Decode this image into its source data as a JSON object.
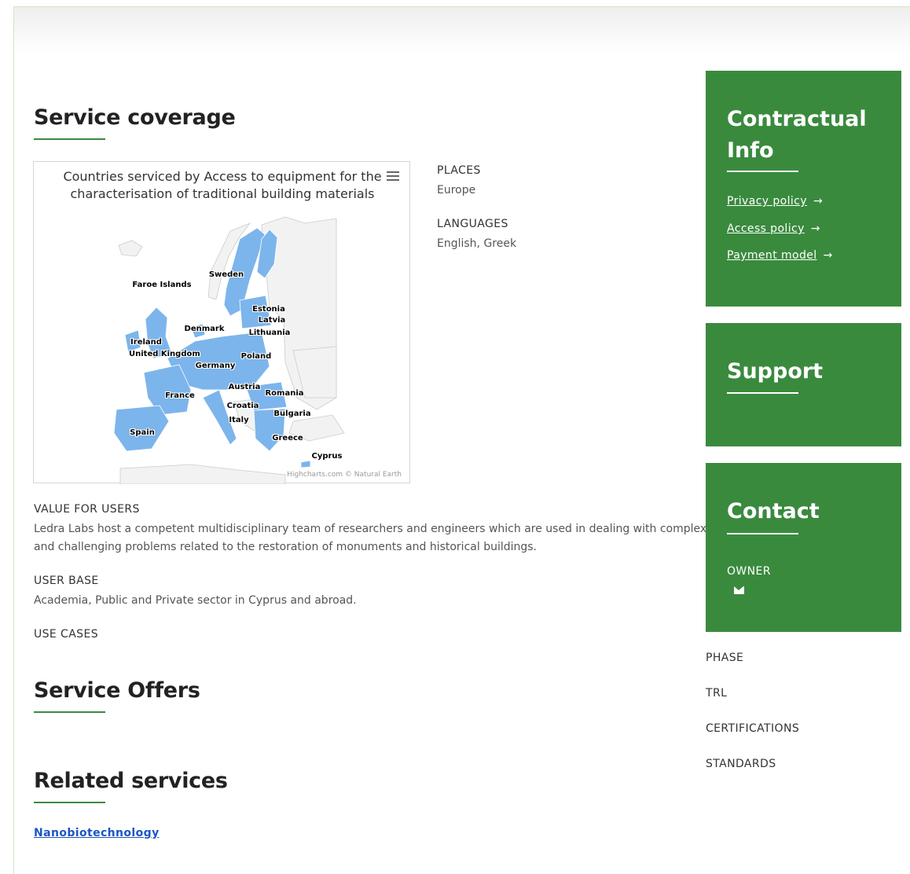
{
  "coverage": {
    "heading": "Service coverage",
    "map_title": "Countries serviced by Access to equipment for the characterisation of traditional building materials",
    "map_credits": "Highcharts.com © Natural Earth",
    "countries": [
      "Sweden",
      "Faroe Islands",
      "Estonia",
      "Latvia",
      "Denmark",
      "Lithuania",
      "Ireland",
      "United Kingdom",
      "Poland",
      "Germany",
      "Austria",
      "France",
      "Romania",
      "Croatia",
      "Bulgaria",
      "Italy",
      "Spain",
      "Greece",
      "Cyprus"
    ],
    "places_label": "PLACES",
    "places_value": "Europe",
    "languages_label": "LANGUAGES",
    "languages_value": "English, Greek"
  },
  "value_for_users": {
    "label": "VALUE FOR USERS",
    "line1": "Ledra Labs host a competent multidisciplinary team of researchers and engineers which are used in dealing with complex",
    "line2": "and challenging problems related to the restoration of monuments and historical buildings."
  },
  "user_base": {
    "label": "USER BASE",
    "value": "Academia, Public and Private sector in Cyprus and abroad."
  },
  "use_cases": {
    "label": "USE CASES"
  },
  "offers": {
    "heading": "Service Offers"
  },
  "related": {
    "heading": "Related services",
    "link": "Nanobiotechnology"
  },
  "contractual": {
    "title_line1": "Contractual",
    "title_line2": "Info",
    "privacy": "Privacy policy",
    "access": "Access policy",
    "payment": "Payment model",
    "arrow": "→"
  },
  "support": {
    "title": "Support"
  },
  "contact": {
    "title": "Contact",
    "owner_label": "OWNER"
  },
  "side_labels": {
    "phase": "PHASE",
    "trl": "TRL",
    "certifications": "CERTIFICATIONS",
    "standards": "STANDARDS"
  },
  "colors": {
    "accent": "#3a8a3e",
    "map_fill": "#7cb5ec",
    "map_land": "#f2f2f2",
    "link": "#1a56c4"
  }
}
